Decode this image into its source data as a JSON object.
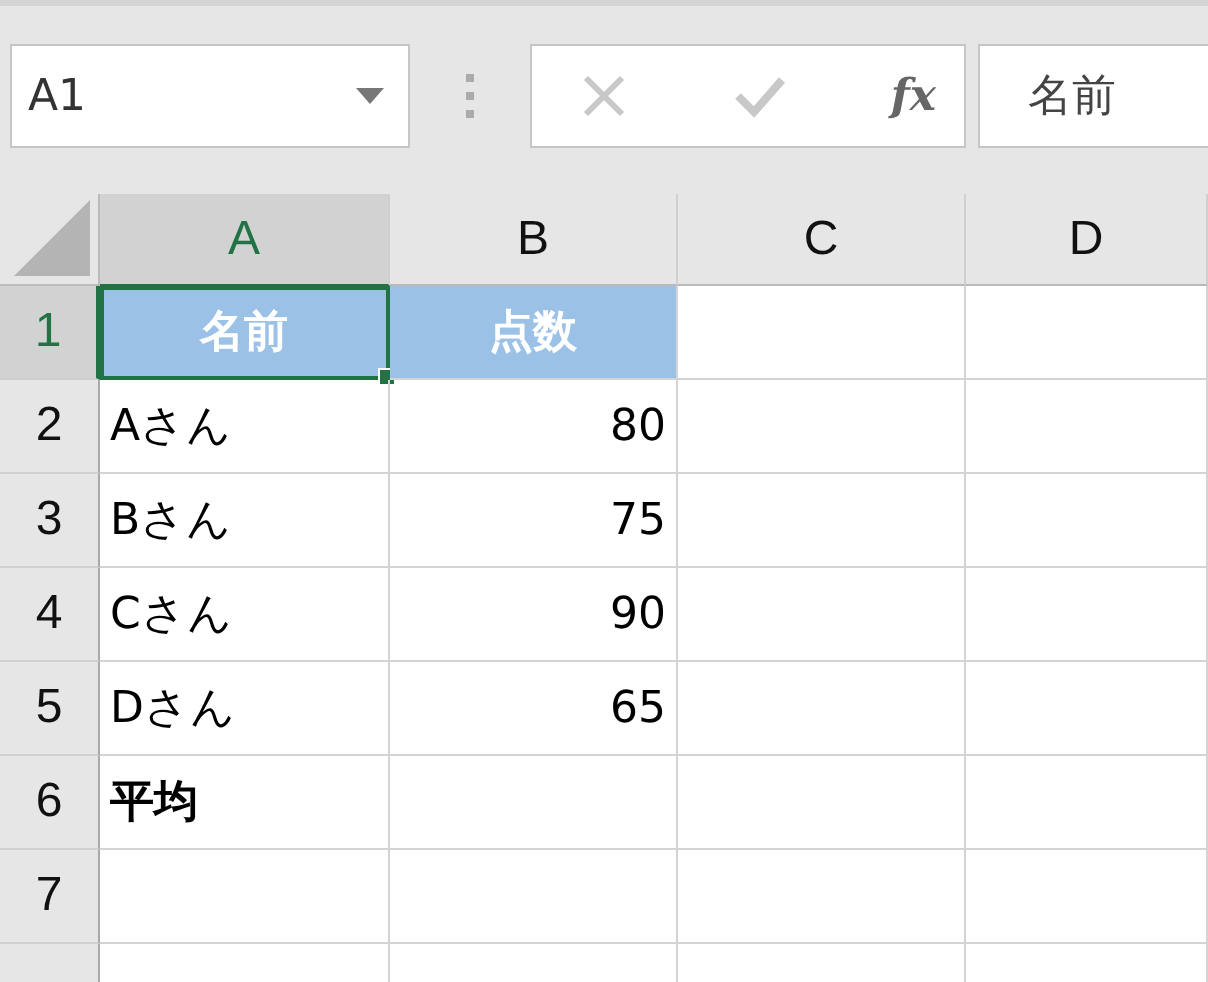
{
  "name_box": {
    "value": "A1"
  },
  "formula_bar": {
    "function_label": "fx",
    "value": "名前"
  },
  "columns": [
    {
      "label": "A",
      "selected": true
    },
    {
      "label": "B",
      "selected": false
    },
    {
      "label": "C",
      "selected": false
    },
    {
      "label": "D",
      "selected": false
    }
  ],
  "rows": [
    {
      "number": "1",
      "selected": true,
      "cells": [
        {
          "text": "名前",
          "kind": "header",
          "selected": true
        },
        {
          "text": "点数",
          "kind": "header",
          "selected": false
        },
        {
          "text": "",
          "kind": "text",
          "selected": false
        },
        {
          "text": "",
          "kind": "text",
          "selected": false
        }
      ]
    },
    {
      "number": "2",
      "selected": false,
      "cells": [
        {
          "text": "Aさん",
          "kind": "text",
          "selected": false
        },
        {
          "text": "80",
          "kind": "number",
          "selected": false
        },
        {
          "text": "",
          "kind": "text",
          "selected": false
        },
        {
          "text": "",
          "kind": "text",
          "selected": false
        }
      ]
    },
    {
      "number": "3",
      "selected": false,
      "cells": [
        {
          "text": "Bさん",
          "kind": "text",
          "selected": false
        },
        {
          "text": "75",
          "kind": "number",
          "selected": false
        },
        {
          "text": "",
          "kind": "text",
          "selected": false
        },
        {
          "text": "",
          "kind": "text",
          "selected": false
        }
      ]
    },
    {
      "number": "4",
      "selected": false,
      "cells": [
        {
          "text": "Cさん",
          "kind": "text",
          "selected": false
        },
        {
          "text": "90",
          "kind": "number",
          "selected": false
        },
        {
          "text": "",
          "kind": "text",
          "selected": false
        },
        {
          "text": "",
          "kind": "text",
          "selected": false
        }
      ]
    },
    {
      "number": "5",
      "selected": false,
      "cells": [
        {
          "text": "Dさん",
          "kind": "text",
          "selected": false
        },
        {
          "text": "65",
          "kind": "number",
          "selected": false
        },
        {
          "text": "",
          "kind": "text",
          "selected": false
        },
        {
          "text": "",
          "kind": "text",
          "selected": false
        }
      ]
    },
    {
      "number": "6",
      "selected": false,
      "cells": [
        {
          "text": "平均",
          "kind": "bold",
          "selected": false
        },
        {
          "text": "",
          "kind": "text",
          "selected": false
        },
        {
          "text": "",
          "kind": "text",
          "selected": false
        },
        {
          "text": "",
          "kind": "text",
          "selected": false
        }
      ]
    },
    {
      "number": "7",
      "selected": false,
      "cells": [
        {
          "text": "",
          "kind": "text",
          "selected": false
        },
        {
          "text": "",
          "kind": "text",
          "selected": false
        },
        {
          "text": "",
          "kind": "text",
          "selected": false
        },
        {
          "text": "",
          "kind": "text",
          "selected": false
        }
      ]
    }
  ]
}
